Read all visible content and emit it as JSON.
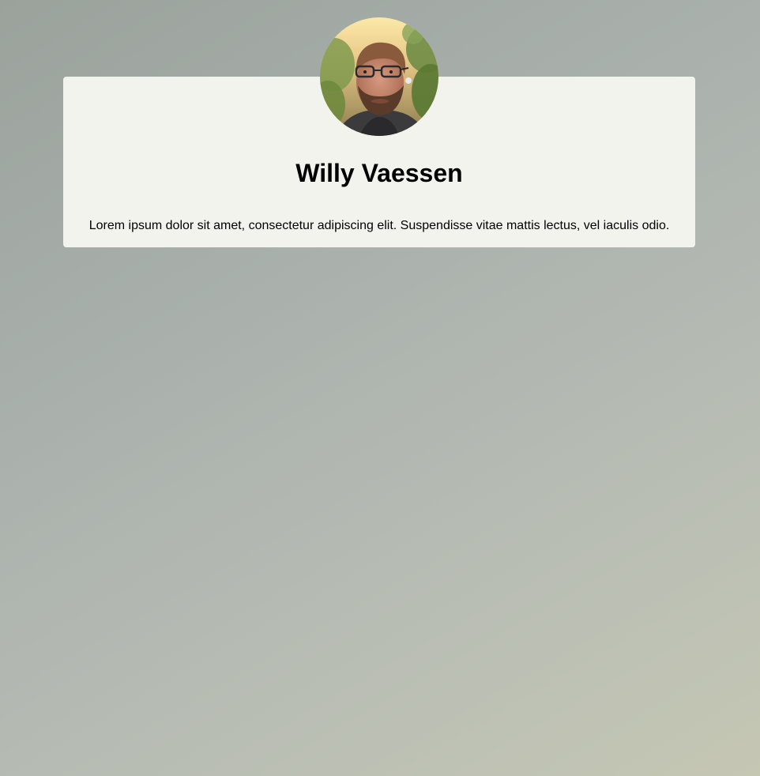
{
  "profile": {
    "name": "Willy Vaessen",
    "bio": "Lorem ipsum dolor sit amet, consectetur adipiscing elit. Suspendisse vitae mattis lectus, vel iaculis odio.",
    "avatar_icon": "profile-photo"
  },
  "colors": {
    "card_background": "#f2f3ec",
    "page_gradient_start": "#9ba29c",
    "page_gradient_end": "#c5c7b3",
    "text": "#000000"
  }
}
